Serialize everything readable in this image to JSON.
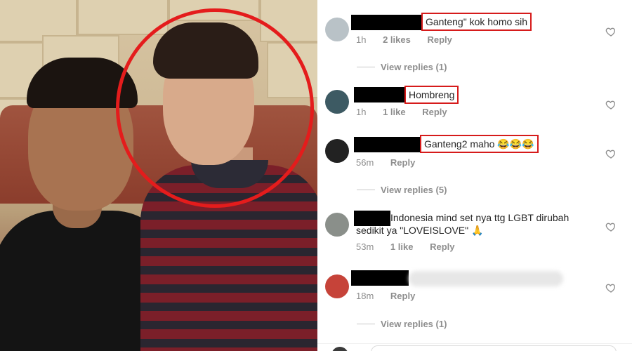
{
  "comments": [
    {
      "text": "Ganteng\" kok homo sih",
      "time": "1h",
      "likes": "2 likes",
      "reply": "Reply",
      "avatar_color": "#b9c2c7"
    },
    {
      "text": "Hombreng",
      "time": "1h",
      "likes": "1 like",
      "reply": "Reply",
      "avatar_color": "#3d5a63"
    },
    {
      "text": "Ganteng2 maho 😂😂😂",
      "time": "56m",
      "reply": "Reply",
      "avatar_color": "#222222"
    },
    {
      "text": "Indonesia mind set nya ttg LGBT dirubah",
      "text_line2": "sedikit ya \"LOVEISLOVE\" 🙏",
      "time": "53m",
      "likes": "1 like",
      "reply": "Reply",
      "avatar_color": "#8a8f8a"
    },
    {
      "time": "18m",
      "reply": "Reply",
      "avatar_color": "#c64339"
    }
  ],
  "view_replies": [
    "View replies (1)",
    "View replies (5)",
    "View replies (1)"
  ],
  "colors": {
    "highlight_box": "#d61b1b",
    "circle": "#e41c1c",
    "meta_text": "#8e8e8e"
  },
  "icons": {
    "like": "heart-outline-icon"
  }
}
